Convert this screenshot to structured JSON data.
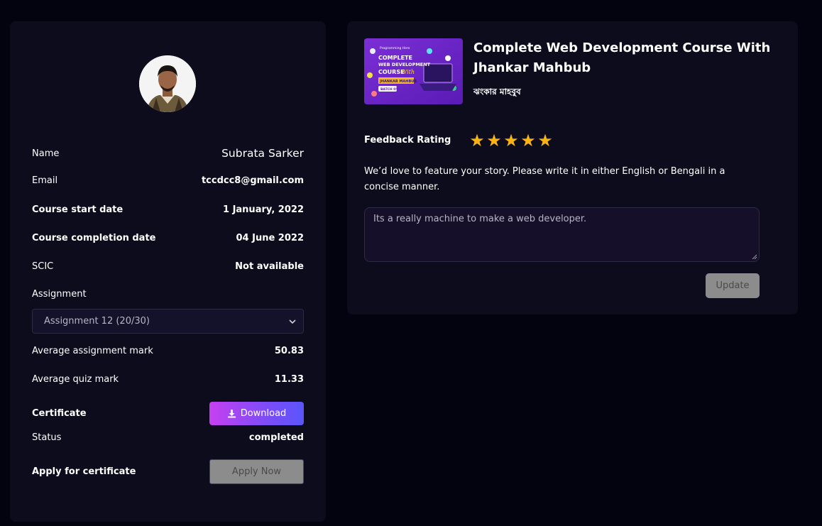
{
  "profile": {
    "name_label": "Name",
    "name_value": "Subrata Sarker",
    "email_label": "Email",
    "email_value": "tccdcc8@gmail.com",
    "start_label": "Course start date",
    "start_value": "1 January, 2022",
    "completion_label": "Course completion date",
    "completion_value": "04 June 2022",
    "scic_label": "SCIC",
    "scic_value": "Not available",
    "assignment_label": "Assignment",
    "assignment_selected": "Assignment 12 (20/30)",
    "avg_assignment_label": "Average assignment mark",
    "avg_assignment_value": "50.83",
    "avg_quiz_label": "Average quiz mark",
    "avg_quiz_value": "11.33",
    "certificate_label": "Certificate",
    "download_label": "Download",
    "status_label": "Status",
    "status_value": "completed",
    "apply_label": "Apply for certificate",
    "apply_button": "Apply Now"
  },
  "course": {
    "title": "Complete Web Development Course With Jhankar Mahbub",
    "author": "ঝংকার মাহবুব",
    "thumbnail": {
      "brand": "Programming Hero",
      "line1": "COMPLETE",
      "line2": "WEB DEVELOPMENT",
      "line3": "COURSE",
      "with": "With",
      "instructor": "JHANKAR MAHBUB",
      "batch": "BATCH 05"
    }
  },
  "feedback": {
    "rating_label": "Feedback Rating",
    "rating": 5,
    "stars": [
      "★",
      "★",
      "★",
      "★",
      "★"
    ],
    "prompt": "We’d love to feature your story. Please write it in either English or Bengali in a concise manner.",
    "story_value": "Its a really machine to make a web developer.",
    "update_button": "Update"
  },
  "colors": {
    "background": "#03030f",
    "card": "#0d0c1d",
    "star": "#fbb214",
    "download_gradient_start": "#c640f0",
    "download_gradient_end": "#5b55fb",
    "disabled_button": "#8c8c8c"
  }
}
